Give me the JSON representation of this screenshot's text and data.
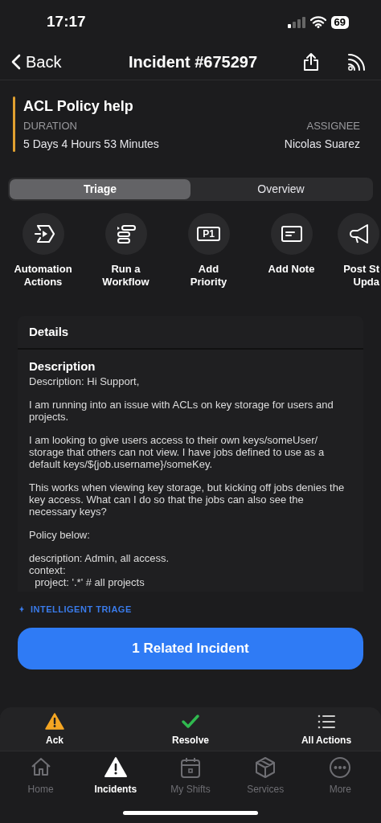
{
  "status_bar": {
    "time": "17:17",
    "battery": "69"
  },
  "nav": {
    "back": "Back",
    "title": "Incident #675297"
  },
  "incident": {
    "title": "ACL Policy help",
    "color": "#e0a030",
    "duration_label": "DURATION",
    "duration": "5 Days 4 Hours 53 Minutes",
    "assignee_label": "ASSIGNEE",
    "assignee": "Nicolas Suarez"
  },
  "tabs": [
    {
      "label": "Triage",
      "selected": true
    },
    {
      "label": "Overview",
      "selected": false
    }
  ],
  "actions": [
    {
      "kind": "automation",
      "lines": [
        "Automation",
        "Actions"
      ]
    },
    {
      "kind": "workflow",
      "lines": [
        "Run a",
        "Workflow"
      ]
    },
    {
      "kind": "priority",
      "icon_text": "P1",
      "lines": [
        "Add",
        "Priority"
      ]
    },
    {
      "kind": "note",
      "lines": [
        "Add Note"
      ]
    },
    {
      "kind": "megaphone",
      "lines": [
        "Post St",
        "Upda"
      ]
    }
  ],
  "details": {
    "title": "Details",
    "section": "Description",
    "paragraphs": [
      "Description: Hi Support,",
      "I am running into an issue with ACLs on key storage for users and projects.",
      "I am looking to give users access to their own keys/someUser/ storage that others can not view. I have jobs defined to use as a default keys/${job.username}/someKey.",
      "This works when viewing key storage, but kicking off jobs denies the key access. What can I do so that the jobs can also see the necessary keys?",
      "Policy below:",
      "description: Admin, all access.\ncontext:\n  project: '.*' # all projects"
    ]
  },
  "triage": {
    "label": "INTELLIGENT TRIAGE",
    "button": "1 Related Incident"
  },
  "quick_actions": [
    {
      "kind": "ack",
      "label": "Ack"
    },
    {
      "kind": "resolve",
      "label": "Resolve"
    },
    {
      "kind": "all",
      "label": "All Actions"
    }
  ],
  "tab_bar": [
    {
      "kind": "home",
      "label": "Home",
      "selected": false
    },
    {
      "kind": "incidents",
      "label": "Incidents",
      "selected": true
    },
    {
      "kind": "shifts",
      "label": "My Shifts",
      "selected": false
    },
    {
      "kind": "services",
      "label": "Services",
      "selected": false
    },
    {
      "kind": "more",
      "label": "More",
      "selected": false
    }
  ]
}
